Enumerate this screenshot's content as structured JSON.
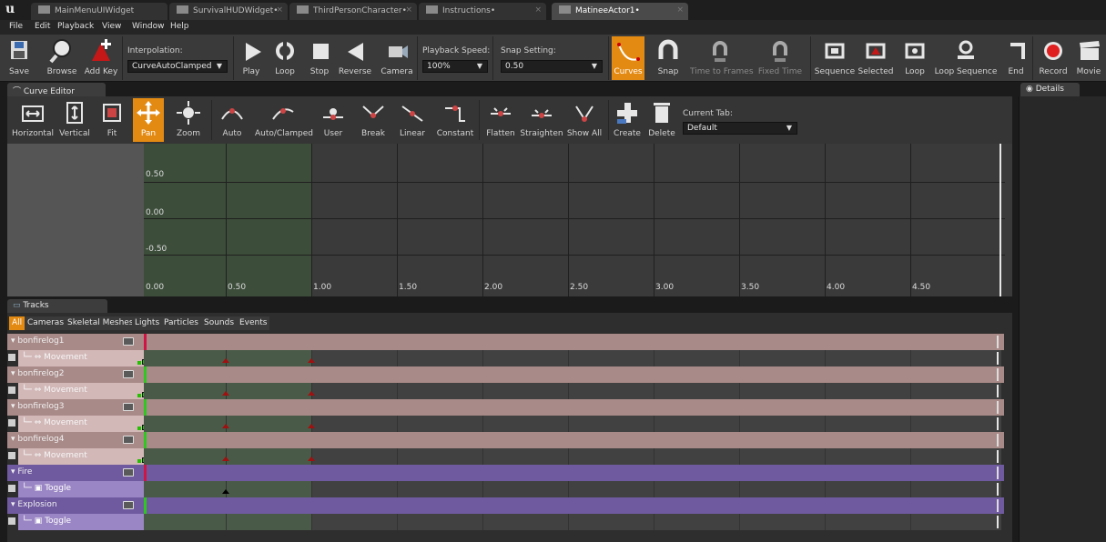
{
  "tabs": [
    {
      "label": "MainMenuUIWidget"
    },
    {
      "label": "SurvivalHUDWidget•"
    },
    {
      "label": "ThirdPersonCharacter•"
    },
    {
      "label": "Instructions•"
    },
    {
      "label": "MatineeActor1•"
    }
  ],
  "menu": [
    "File",
    "Edit",
    "Playback",
    "View",
    "Window",
    "Help"
  ],
  "toolbar": {
    "save": "Save",
    "browse": "Browse",
    "add_key": "Add Key",
    "interpolation_label": "Interpolation:",
    "interpolation_value": "CurveAutoClamped",
    "play": "Play",
    "loop": "Loop",
    "stop": "Stop",
    "reverse": "Reverse",
    "camera": "Camera",
    "playback_speed_label": "Playback Speed:",
    "playback_speed_value": "100%",
    "snap_setting_label": "Snap Setting:",
    "snap_setting_value": "0.50",
    "curves": "Curves",
    "snap": "Snap",
    "time_to_frames": "Time to Frames",
    "fixed_time": "Fixed Time",
    "sequence": "Sequence",
    "selected": "Selected",
    "loop2": "Loop",
    "loop_sequence": "Loop Sequence",
    "end": "End",
    "record": "Record",
    "movie": "Movie"
  },
  "curve_editor": {
    "tab_label": "Curve Editor",
    "buttons": {
      "horizontal": "Horizontal",
      "vertical": "Vertical",
      "fit": "Fit",
      "pan": "Pan",
      "zoom": "Zoom",
      "auto": "Auto",
      "auto_clamped": "Auto/Clamped",
      "user": "User",
      "break": "Break",
      "linear": "Linear",
      "constant": "Constant",
      "flatten": "Flatten",
      "straighten": "Straighten",
      "show_all": "Show All",
      "create": "Create",
      "delete": "Delete"
    },
    "current_tab_label": "Current Tab:",
    "current_tab_value": "Default",
    "y_labels": [
      "0.50",
      "0.00",
      "-0.50"
    ],
    "x_labels": [
      "0.00",
      "0.50",
      "1.00",
      "1.50",
      "2.00",
      "2.50",
      "3.00",
      "3.50",
      "4.00",
      "4.50"
    ]
  },
  "details": {
    "tab_label": "Details"
  },
  "tracks": {
    "tab_label": "Tracks",
    "filters": [
      "All",
      "Cameras",
      "Skeletal Meshes",
      "Lights",
      "Particles",
      "Sounds",
      "Events"
    ],
    "rows": [
      {
        "label": "bonfirelog1",
        "kind": "group"
      },
      {
        "label": "Movement",
        "kind": "movement"
      },
      {
        "label": "bonfirelog2",
        "kind": "group"
      },
      {
        "label": "Movement",
        "kind": "movement"
      },
      {
        "label": "bonfirelog3",
        "kind": "group"
      },
      {
        "label": "Movement",
        "kind": "movement"
      },
      {
        "label": "bonfirelog4",
        "kind": "group"
      },
      {
        "label": "Movement",
        "kind": "movement"
      },
      {
        "label": "Fire",
        "kind": "fx-group"
      },
      {
        "label": "Toggle",
        "kind": "toggle"
      },
      {
        "label": "Explosion",
        "kind": "fx-group"
      },
      {
        "label": "Toggle",
        "kind": "toggle"
      }
    ]
  },
  "colors": {
    "accent": "#e38a12",
    "group_row": "#a88a88",
    "fx_row": "#6f5aa0",
    "key_red": "#a01010"
  }
}
